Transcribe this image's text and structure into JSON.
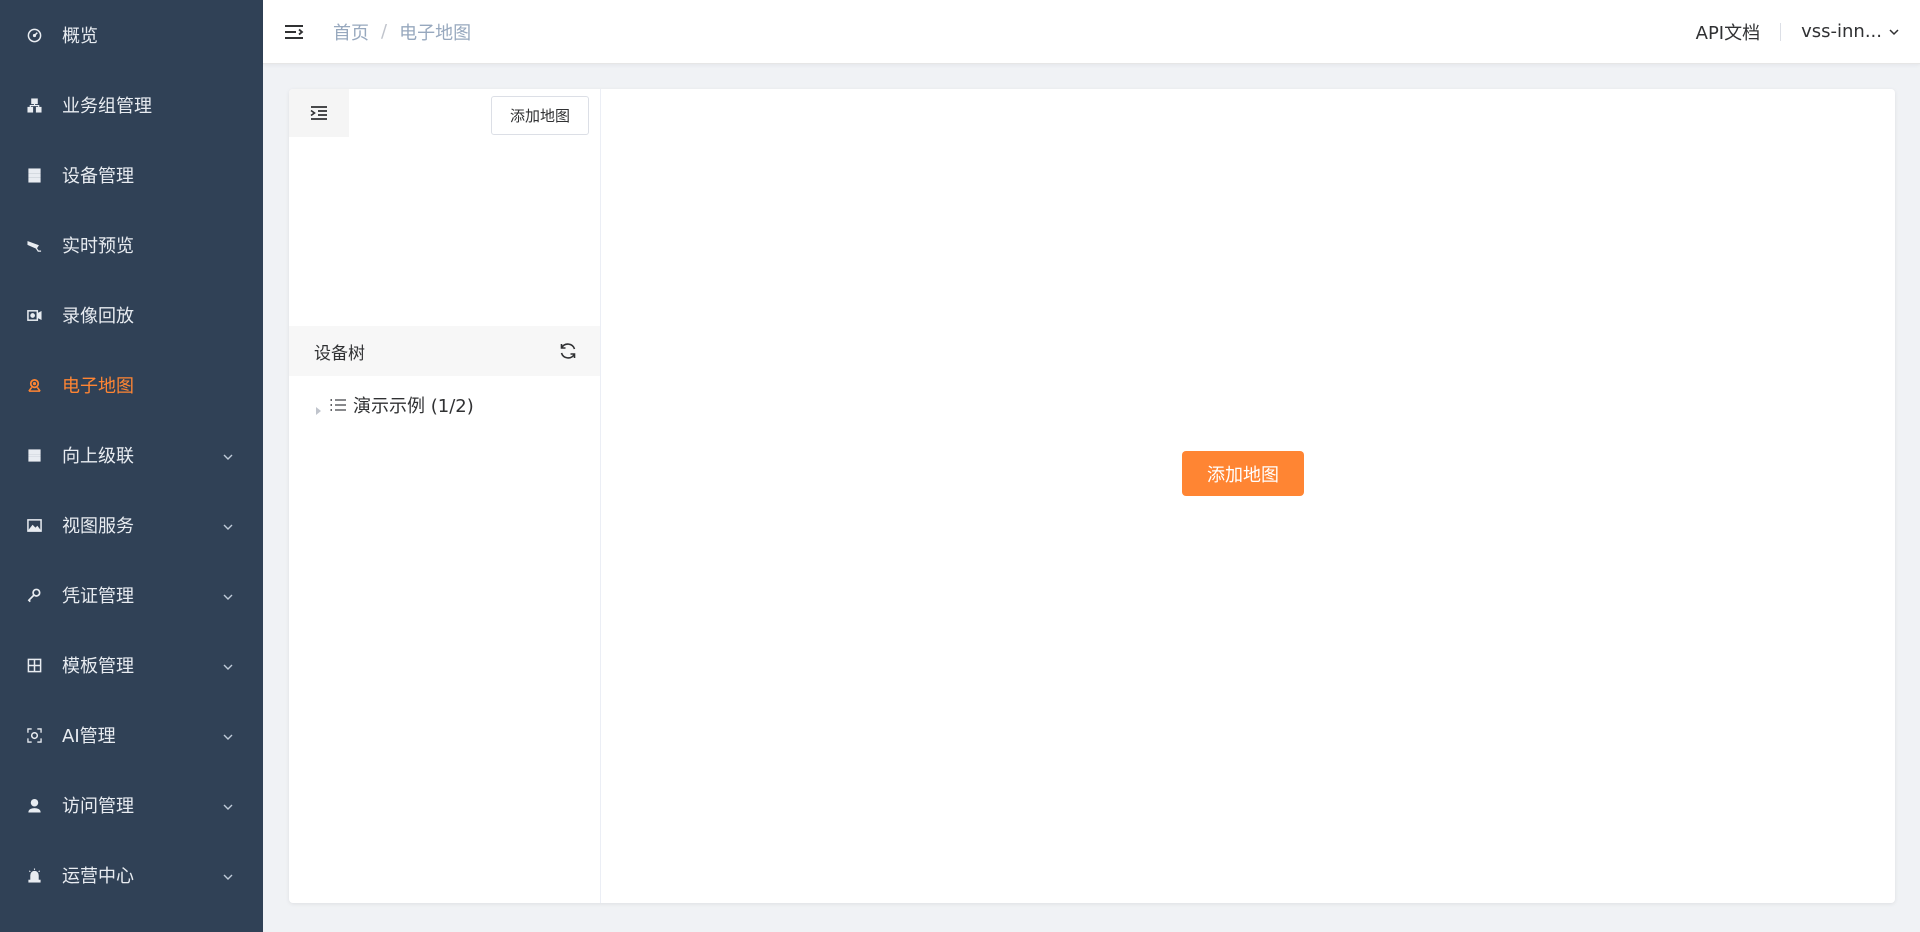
{
  "sidebar": {
    "items": [
      {
        "label": "概览",
        "icon": "dashboard-icon",
        "has_arrow": false
      },
      {
        "label": "业务组管理",
        "icon": "org-tree-icon",
        "has_arrow": false
      },
      {
        "label": "设备管理",
        "icon": "server-icon",
        "has_arrow": false
      },
      {
        "label": "实时预览",
        "icon": "camera-live-icon",
        "has_arrow": false
      },
      {
        "label": "录像回放",
        "icon": "video-record-icon",
        "has_arrow": false
      },
      {
        "label": "电子地图",
        "icon": "map-pin-icon",
        "has_arrow": false,
        "active": true
      },
      {
        "label": "向上级联",
        "icon": "cascade-icon",
        "has_arrow": true
      },
      {
        "label": "视图服务",
        "icon": "image-icon",
        "has_arrow": true
      },
      {
        "label": "凭证管理",
        "icon": "key-icon",
        "has_arrow": true
      },
      {
        "label": "模板管理",
        "icon": "grid-icon",
        "has_arrow": true
      },
      {
        "label": "AI管理",
        "icon": "ai-scan-icon",
        "has_arrow": true
      },
      {
        "label": "访问管理",
        "icon": "user-icon",
        "has_arrow": true
      },
      {
        "label": "运营中心",
        "icon": "alarm-icon",
        "has_arrow": true
      }
    ],
    "active_color": "#ff8533",
    "background": "#304156"
  },
  "topbar": {
    "breadcrumb": [
      "首页",
      "电子地图"
    ],
    "api_docs": "API文档",
    "user": "vss-inn..."
  },
  "left_panel": {
    "add_map_label": "添加地图",
    "tree_title": "设备树",
    "tree_nodes": [
      {
        "label": "演示示例 (1/2)"
      }
    ]
  },
  "map_area": {
    "add_map_label": "添加地图",
    "accent_color": "#ff8533"
  }
}
